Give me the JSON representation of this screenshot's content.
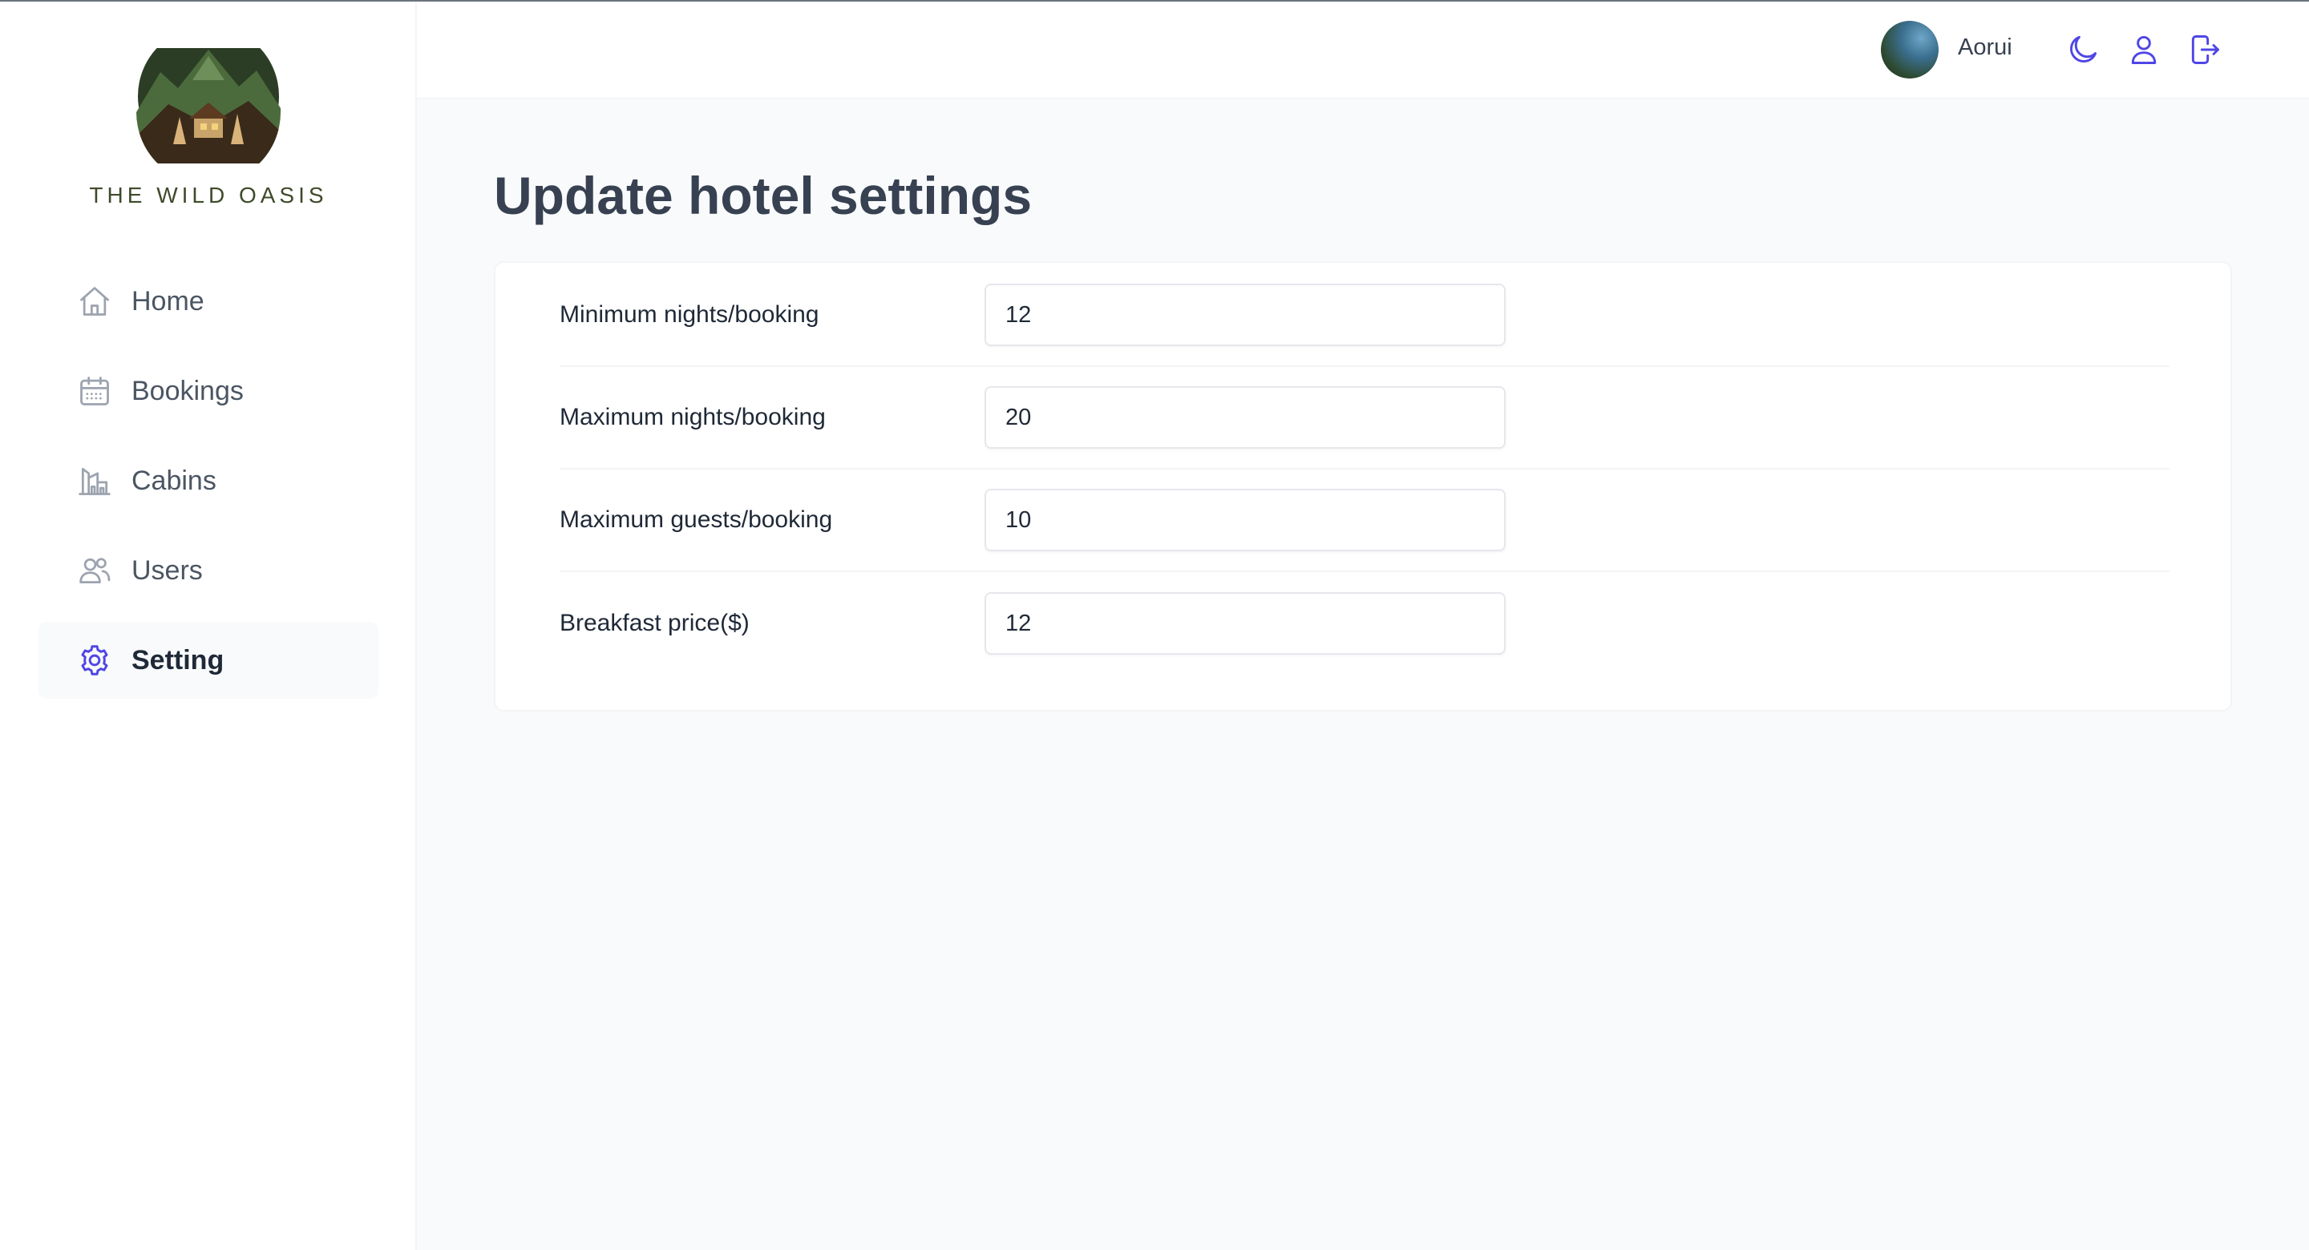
{
  "brand": {
    "logo_text": "THE WILD OASIS"
  },
  "sidebar": {
    "items": [
      {
        "label": "Home",
        "icon": "home-icon",
        "active": false
      },
      {
        "label": "Bookings",
        "icon": "calendar-icon",
        "active": false
      },
      {
        "label": "Cabins",
        "icon": "cabins-icon",
        "active": false
      },
      {
        "label": "Users",
        "icon": "users-icon",
        "active": false
      },
      {
        "label": "Setting",
        "icon": "gear-icon",
        "active": true
      }
    ]
  },
  "header": {
    "user_name": "Aorui",
    "buttons": [
      "moon-icon",
      "user-icon",
      "logout-icon"
    ]
  },
  "main": {
    "title": "Update hotel settings",
    "fields": [
      {
        "label": "Minimum nights/booking",
        "value": "12"
      },
      {
        "label": "Maximum nights/booking",
        "value": "20"
      },
      {
        "label": "Maximum guests/booking",
        "value": "10"
      },
      {
        "label": "Breakfast price($)",
        "value": "12"
      }
    ]
  },
  "colors": {
    "accent": "#4f46e5",
    "sidebar_icon": "#9ca3af",
    "text_dark": "#374151",
    "background": "#f9fafb"
  }
}
